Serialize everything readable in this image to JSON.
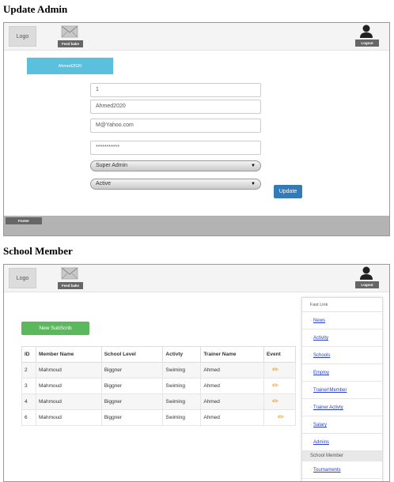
{
  "update_admin": {
    "heading": "Update Admin",
    "header": {
      "logo": "Logo",
      "feedback": "Feed bake",
      "logout": "Logout"
    },
    "username_tab": "Ahmed2020",
    "fields": {
      "id": "1",
      "username": "Ahmed2020",
      "email": "M@Yahoo.com",
      "password": "***********"
    },
    "role_select": "Super Admin",
    "status_select": "Active",
    "update_label": "Update",
    "footer": "Footer"
  },
  "school_member": {
    "heading": "School Member",
    "header": {
      "logo": "Logo",
      "feedback": "Feed bake",
      "logout": "Logout"
    },
    "new_button": "New SubScrib",
    "columns": [
      "ID",
      "Member Name",
      "School Level",
      "Activty",
      "Trainer Name",
      "Event"
    ],
    "rows": [
      [
        "2",
        "Mahmoud",
        "Biggner",
        "Swiming",
        "Ahmed"
      ],
      [
        "3",
        "Mahmoud",
        "Biggner",
        "Swiming",
        "Ahmed"
      ],
      [
        "4",
        "Mahmoud",
        "Biggner",
        "Swiming",
        "Ahmed"
      ],
      [
        "6",
        "Mahmoud",
        "Biggner",
        "Swiming",
        "Ahmed"
      ]
    ],
    "edit_icon": "pencil-icon",
    "fast_link": {
      "title": "Fast Link",
      "items": [
        "News",
        "Activity",
        "Schools",
        "Employ",
        "Trainer\\Member",
        "Trainer Activty",
        "Salary",
        "Admins"
      ],
      "active": "School Member",
      "last": "Tournaments"
    }
  },
  "colors": {
    "accent_blue": "#337ab7",
    "tab_cyan": "#5bc0de",
    "success_green": "#5cb85c",
    "link_blue": "#2a3ec8"
  }
}
